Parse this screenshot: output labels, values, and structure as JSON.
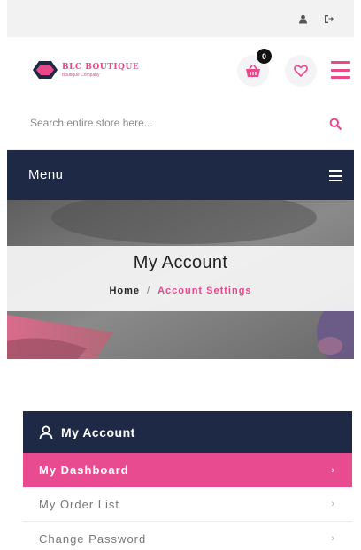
{
  "header": {
    "logo_name": "BLC BOUTIQUE",
    "logo_tagline": "Boutique Company",
    "cart_count": "0",
    "icons": [
      "user-icon",
      "logout-icon",
      "cart-icon",
      "heart-icon",
      "hamburger-icon"
    ]
  },
  "search": {
    "placeholder": "Search entire store here...",
    "value": ""
  },
  "menu": {
    "label": "Menu"
  },
  "banner": {
    "title": "My Account",
    "breadcrumb_home": "Home",
    "breadcrumb_separator": "/",
    "breadcrumb_current": "Account Settings"
  },
  "account": {
    "title": "My Account",
    "items": [
      {
        "label": "My Dashboard",
        "active": true
      },
      {
        "label": "My Order List",
        "active": false
      },
      {
        "label": "Change Password",
        "active": false
      }
    ],
    "chevron": "›"
  },
  "colors": {
    "navy": "#1e2a45",
    "pink": "#e94b90",
    "topbar": "#f2f2f2"
  }
}
